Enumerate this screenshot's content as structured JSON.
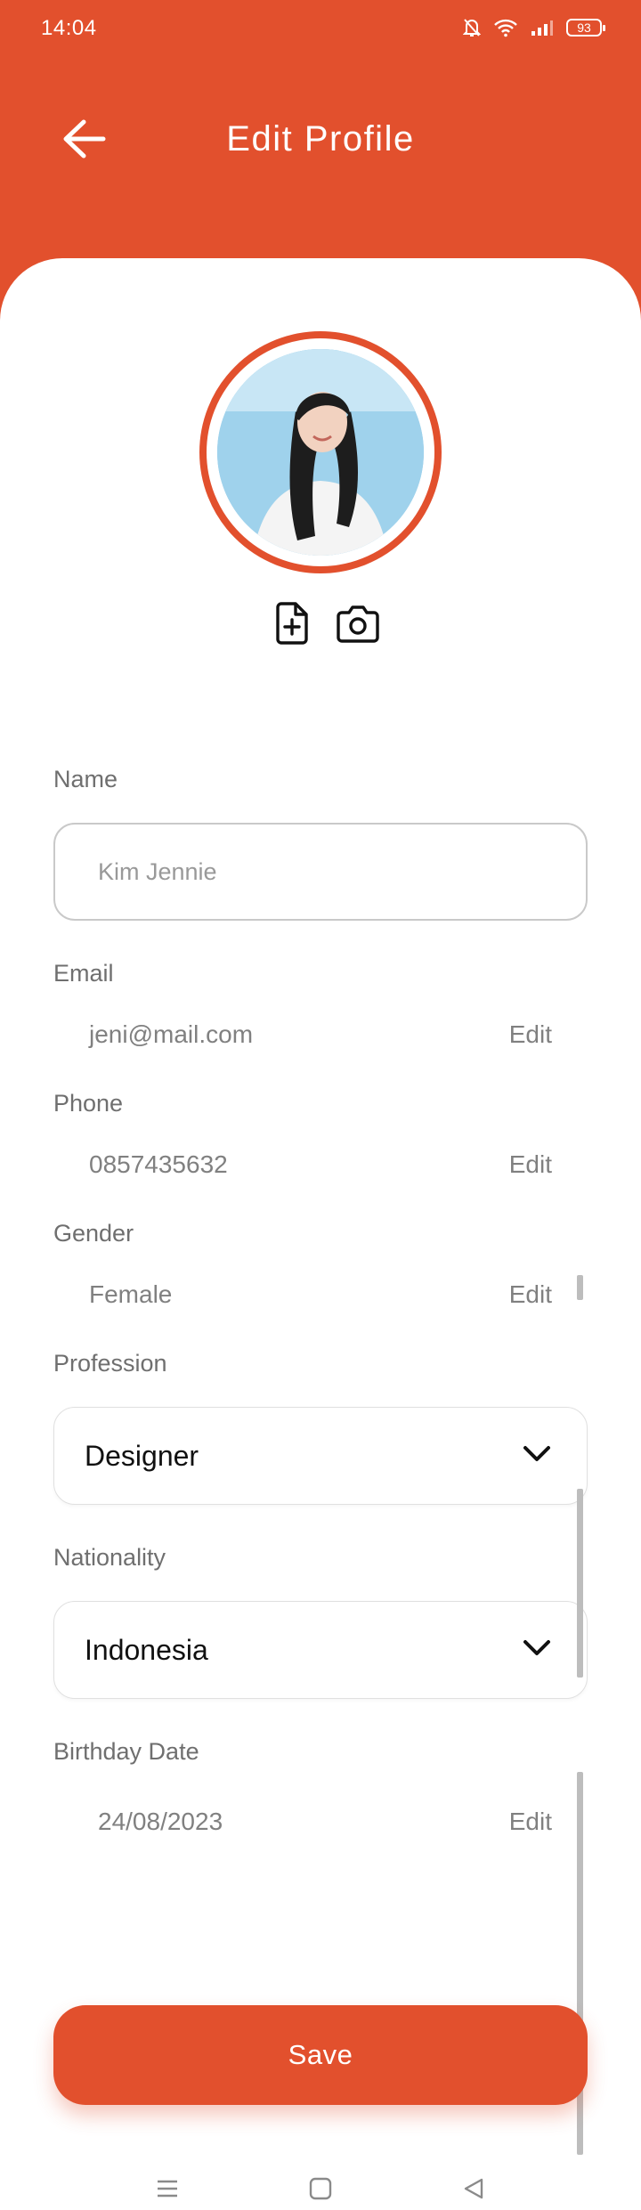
{
  "status_bar": {
    "time": "14:04",
    "battery": "93"
  },
  "header": {
    "title": "Edit Profile",
    "back_icon": "arrow-left-icon"
  },
  "avatar": {
    "actions": [
      {
        "icon": "file-plus-icon"
      },
      {
        "icon": "camera-icon"
      }
    ]
  },
  "form": {
    "name": {
      "label": "Name",
      "placeholder": "Kim Jennie"
    },
    "email": {
      "label": "Email",
      "value": "jeni@mail.com",
      "action": "Edit"
    },
    "phone": {
      "label": "Phone",
      "value": "0857435632",
      "action": "Edit"
    },
    "gender": {
      "label": "Gender",
      "value": "Female",
      "action": "Edit"
    },
    "profession": {
      "label": "Profession",
      "selected": "Designer"
    },
    "nationality": {
      "label": "Nationality",
      "selected": "Indonesia"
    },
    "birthday": {
      "label": "Birthday Date",
      "value": "24/08/2023",
      "action": "Edit"
    }
  },
  "save_label": "Save",
  "colors": {
    "accent": "#e2502d",
    "label": "#6f6f6f",
    "muted": "#808080"
  },
  "nav": {
    "icons": [
      "menu-icon",
      "home-icon",
      "back-triangle-icon"
    ]
  }
}
